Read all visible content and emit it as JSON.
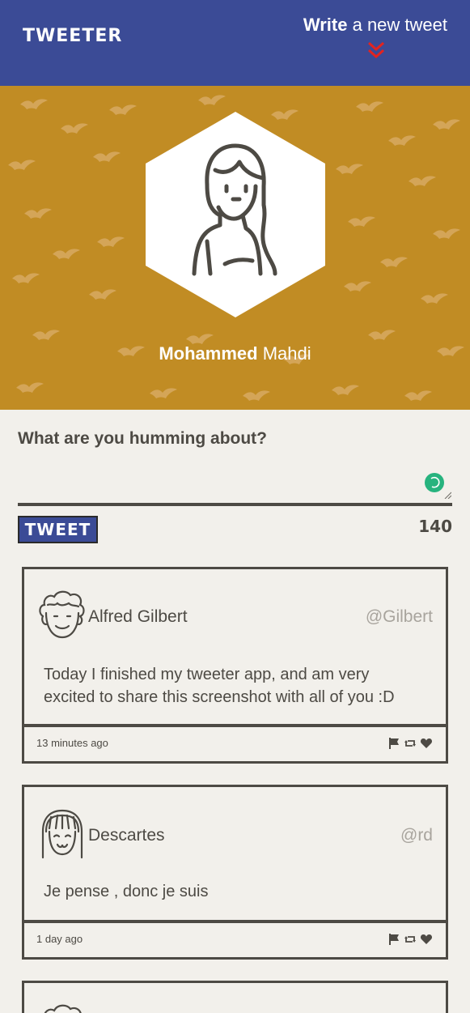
{
  "nav": {
    "brand": "TWEETER",
    "compose_strong": "Write",
    "compose_rest": " a new tweet"
  },
  "profile": {
    "first_name": "Mohammed",
    "last_name": " Mahdi"
  },
  "composer": {
    "label": "What are you humming about?",
    "value": "",
    "button": "TWEET",
    "counter": "140"
  },
  "tweets": [
    {
      "author": "Alfred Gilbert",
      "handle": "@Gilbert",
      "text_line1": "Today I finished my tweeter app, and am very",
      "text_line2": "excited to share this screenshot with all of you :D",
      "time": "13 minutes ago",
      "avatar_icon": "curly-hair-avatar-icon"
    },
    {
      "author": "Descartes",
      "handle": "@rd",
      "text_line1": "Je pense , donc je suis",
      "text_line2": "",
      "time": "1 day ago",
      "avatar_icon": "bangs-hair-avatar-icon"
    }
  ],
  "colors": {
    "nav": "#3b4b96",
    "header": "#c18c24",
    "background": "#f2f0eb",
    "text": "#4d4a44",
    "handle": "#a8a49d",
    "chevron": "#e3231f",
    "spinner": "#27b37e"
  }
}
